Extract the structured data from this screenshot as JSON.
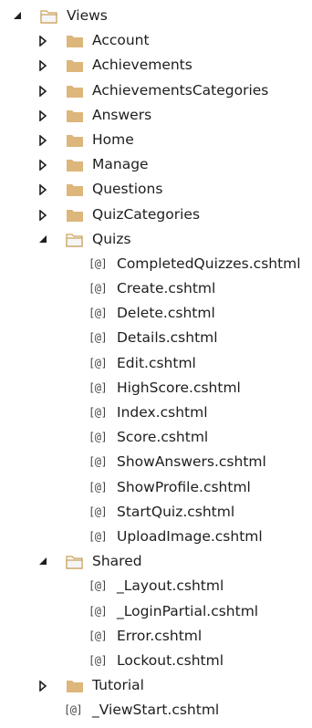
{
  "colors": {
    "folder_fill": "#dcb67a",
    "folder_dark": "#c8a05a",
    "arrow": "#1e1e1e",
    "text": "#1e1e1e"
  },
  "razor_prefix": "[@]",
  "tree": {
    "root": {
      "label": "Views",
      "expanded": true
    },
    "folders": [
      {
        "label": "Account",
        "expanded": false
      },
      {
        "label": "Achievements",
        "expanded": false
      },
      {
        "label": "AchievementsCategories",
        "expanded": false
      },
      {
        "label": "Answers",
        "expanded": false
      },
      {
        "label": "Home",
        "expanded": false
      },
      {
        "label": "Manage",
        "expanded": false
      },
      {
        "label": "Questions",
        "expanded": false
      },
      {
        "label": "QuizCategories",
        "expanded": false
      },
      {
        "label": "Quizs",
        "expanded": true,
        "files": [
          "CompletedQuizzes.cshtml",
          "Create.cshtml",
          "Delete.cshtml",
          "Details.cshtml",
          "Edit.cshtml",
          "HighScore.cshtml",
          "Index.cshtml",
          "Score.cshtml",
          "ShowAnswers.cshtml",
          "ShowProfile.cshtml",
          "StartQuiz.cshtml",
          "UploadImage.cshtml"
        ]
      },
      {
        "label": "Shared",
        "expanded": true,
        "files": [
          "_Layout.cshtml",
          "_LoginPartial.cshtml",
          "Error.cshtml",
          "Lockout.cshtml"
        ]
      },
      {
        "label": "Tutorial",
        "expanded": false
      }
    ],
    "root_files": [
      "_ViewStart.cshtml"
    ]
  }
}
